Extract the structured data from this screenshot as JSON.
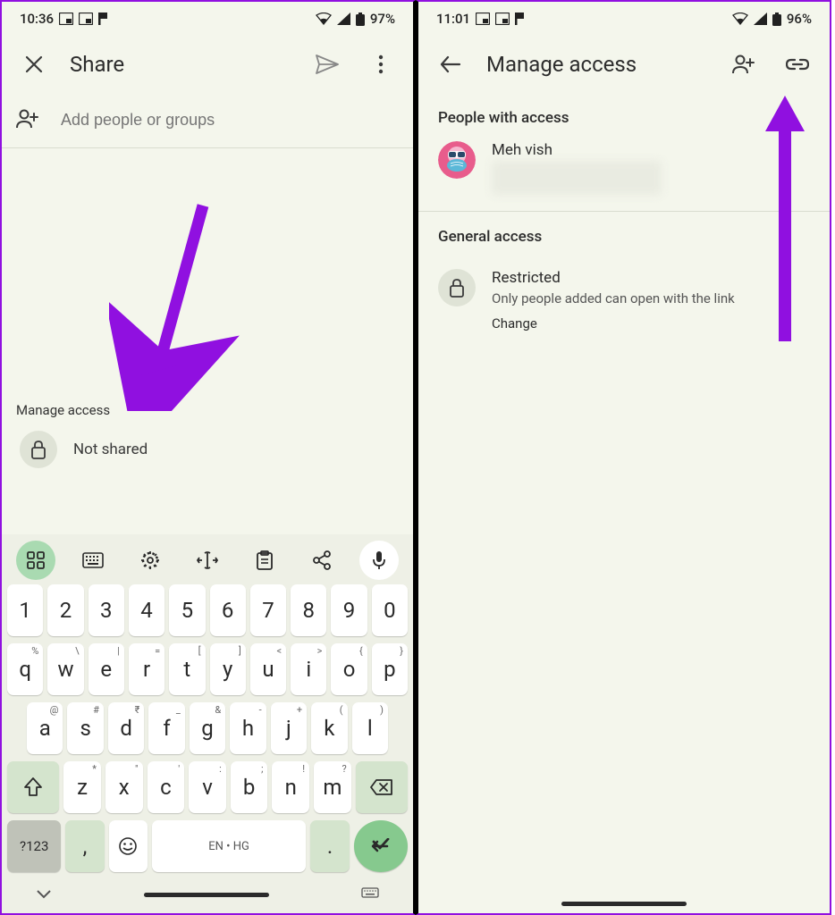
{
  "left": {
    "status": {
      "time": "10:36",
      "battery": "97%"
    },
    "toolbar": {
      "title": "Share"
    },
    "addPeople": {
      "placeholder": "Add people or groups"
    },
    "manageAccess": {
      "label": "Manage access",
      "status": "Not shared"
    },
    "keyboard": {
      "row1": [
        "1",
        "2",
        "3",
        "4",
        "5",
        "6",
        "7",
        "8",
        "9",
        "0"
      ],
      "row2": [
        {
          "k": "q",
          "h": "%"
        },
        {
          "k": "w",
          "h": "\\"
        },
        {
          "k": "e",
          "h": "|"
        },
        {
          "k": "r",
          "h": "="
        },
        {
          "k": "t",
          "h": "["
        },
        {
          "k": "y",
          "h": "]"
        },
        {
          "k": "u",
          "h": "<"
        },
        {
          "k": "i",
          "h": ">"
        },
        {
          "k": "o",
          "h": "{"
        },
        {
          "k": "p",
          "h": "}"
        }
      ],
      "row3": [
        {
          "k": "a",
          "h": "@"
        },
        {
          "k": "s",
          "h": "#"
        },
        {
          "k": "d",
          "h": "₹"
        },
        {
          "k": "f",
          "h": "_"
        },
        {
          "k": "g",
          "h": "&"
        },
        {
          "k": "h",
          "h": "-"
        },
        {
          "k": "j",
          "h": "+"
        },
        {
          "k": "k",
          "h": "("
        },
        {
          "k": "l",
          "h": ")"
        }
      ],
      "row4": [
        {
          "k": "z",
          "h": "*"
        },
        {
          "k": "x",
          "h": "\""
        },
        {
          "k": "c",
          "h": "'"
        },
        {
          "k": "v",
          "h": ":"
        },
        {
          "k": "b",
          "h": ";"
        },
        {
          "k": "n",
          "h": "!"
        },
        {
          "k": "m",
          "h": "?"
        }
      ],
      "symKey": "?123",
      "spaceLabel": "EN • HG",
      "comma": ",",
      "period": "."
    }
  },
  "right": {
    "status": {
      "time": "11:01",
      "battery": "96%"
    },
    "toolbar": {
      "title": "Manage access"
    },
    "peopleHeader": "People with access",
    "person": {
      "name": "Meh vish"
    },
    "generalHeader": "General access",
    "restricted": {
      "title": "Restricted",
      "sub": "Only people added can open with the link",
      "change": "Change"
    }
  }
}
